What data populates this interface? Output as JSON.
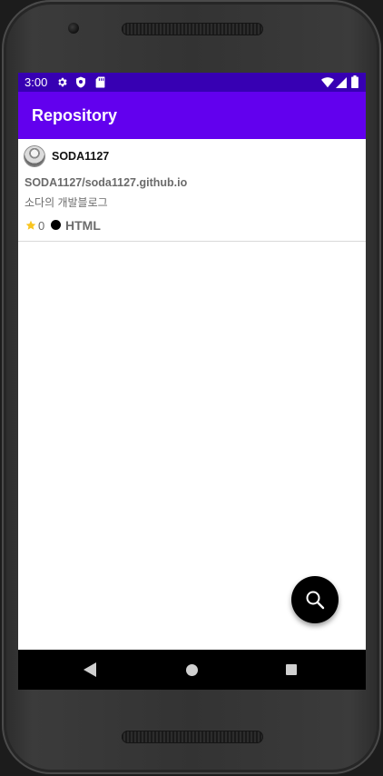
{
  "status_bar": {
    "time": "3:00",
    "icons": [
      "gear-icon",
      "shield-icon",
      "sd-card-icon",
      "wifi-icon",
      "cell-signal-icon",
      "battery-icon"
    ]
  },
  "app_bar": {
    "title": "Repository"
  },
  "repositories": [
    {
      "owner": "SODA1127",
      "full_name": "SODA1127/soda1127.github.io",
      "description": "소다의 개발블로그",
      "stars": "0",
      "language": "HTML",
      "language_color": "#000000"
    }
  ],
  "fab": {
    "icon": "search-icon"
  },
  "navigation_bar": {
    "icons": [
      "back-icon",
      "home-icon",
      "recents-icon"
    ]
  },
  "colors": {
    "status_bar": "#3700b3",
    "app_bar": "#6200ee",
    "star": "#f9c51f",
    "fab": "#000000"
  }
}
